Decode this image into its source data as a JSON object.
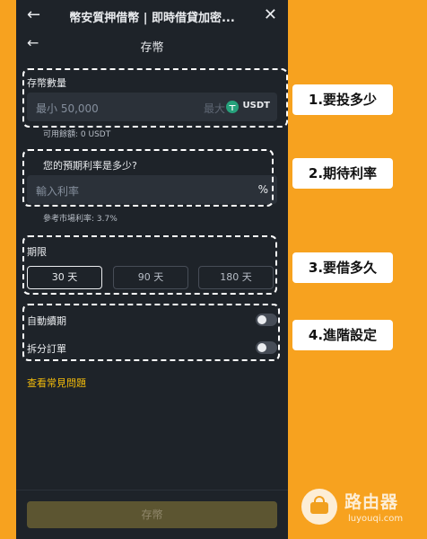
{
  "app": {
    "window_title": "幣安質押借幣 | 即時借貸加密...",
    "page_title": "存幣"
  },
  "deposit_amount": {
    "label": "存幣數量",
    "placeholder": "最小 50,000",
    "max_label": "最大",
    "coin": "USDT",
    "available": "可用餘額: 0 USDT"
  },
  "interest": {
    "label": "您的預期利率是多少?",
    "placeholder": "輸入利率",
    "unit": "%",
    "reference": "參考市場利率: 3.7%"
  },
  "term": {
    "label": "期限",
    "options": [
      "30 天",
      "90 天",
      "180 天"
    ],
    "selected": "30 天"
  },
  "settings": {
    "auto_renew": {
      "label": "自動續期",
      "enabled": false
    },
    "split_order": {
      "label": "拆分訂單",
      "enabled": false
    }
  },
  "faq_link": "查看常見問題",
  "submit_label": "存幣",
  "annotations": [
    "1.要投多少",
    "2.期待利率",
    "3.要借多久",
    "4.進階設定"
  ],
  "watermark": {
    "name": "路由器",
    "url": "luyouqi.com"
  },
  "colors": {
    "background": "#f7a21f",
    "panel": "#1e2329",
    "input": "#2b3139",
    "accent": "#f0b90b",
    "usdt": "#26a17b"
  }
}
